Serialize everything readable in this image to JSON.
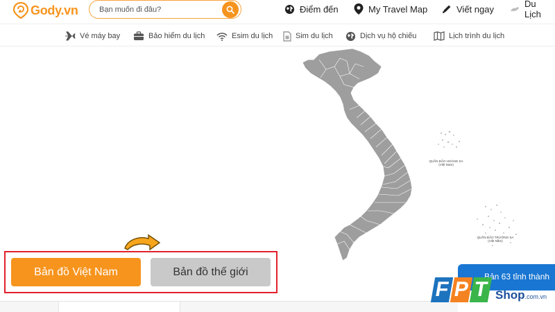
{
  "header": {
    "logo_text": "Gody.vn",
    "search_placeholder": "Bạn muốn đi đâu?",
    "nav": [
      {
        "label": "Điểm đến",
        "icon": "globe-icon"
      },
      {
        "label": "My Travel Map",
        "icon": "map-pin-icon"
      },
      {
        "label": "Viết ngay",
        "icon": "pencil-icon"
      },
      {
        "label": "Du Lịch",
        "icon": "travel-icon"
      }
    ]
  },
  "subnav": [
    {
      "label": "Vé máy bay",
      "icon": "airplane-icon"
    },
    {
      "label": "Bảo hiểm du lịch",
      "icon": "briefcase-icon"
    },
    {
      "label": "Esim du lịch",
      "icon": "wifi-icon"
    },
    {
      "label": "Sim du lịch",
      "icon": "sim-card-icon"
    },
    {
      "label": "Dịch vụ hộ chiếu",
      "icon": "globe-icon"
    },
    {
      "label": "Lịch trình du lịch",
      "icon": "map-icon"
    }
  ],
  "map": {
    "labels": {
      "hoang_sa_1": "QUẦN ĐẢO HOÀNG SA",
      "hoang_sa_2": "(Việt Nam)",
      "truong_sa_1": "QUẦN ĐẢO TRƯỜNG SA",
      "truong_sa_2": "(Việt Nam)"
    },
    "fill_color": "#9e9e9e"
  },
  "selector": {
    "vietnam_map": "Bản đồ Việt Nam",
    "world_map": "Bản đồ thế giới"
  },
  "badge": {
    "label": "Bản 63 tỉnh thành"
  },
  "watermark": {
    "letters": [
      "F",
      "P",
      "T"
    ],
    "shop": "Shop",
    "domain": ".com.vn"
  },
  "colors": {
    "brand_orange": "#f7941d",
    "highlight_red": "#e2202b",
    "button_gray": "#c9c9c9",
    "badge_blue": "#1976d2"
  }
}
